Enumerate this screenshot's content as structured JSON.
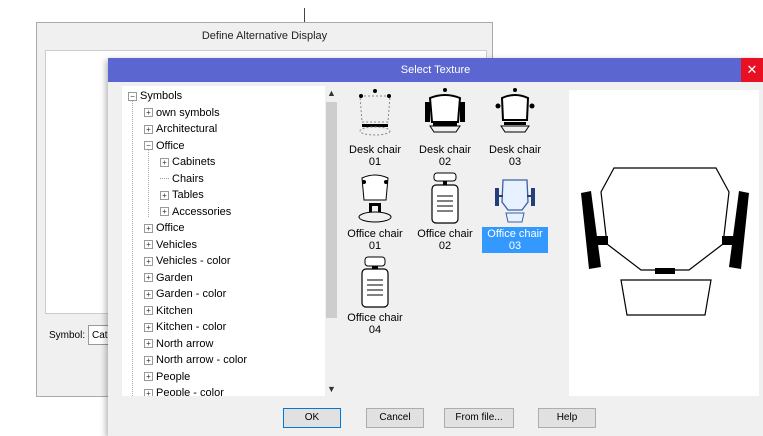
{
  "background_dialog": {
    "title": "Define Alternative Display",
    "symbol_label": "Symbol:",
    "symbol_value": "Cata"
  },
  "dialog": {
    "title": "Select Texture",
    "close_glyph": "✕"
  },
  "tree": {
    "items": [
      {
        "label": "Symbols",
        "indent": 0,
        "expander": "−"
      },
      {
        "label": "own symbols",
        "indent": 1,
        "expander": "+"
      },
      {
        "label": "Architectural",
        "indent": 1,
        "expander": "+"
      },
      {
        "label": "Office",
        "indent": 1,
        "expander": "−"
      },
      {
        "label": "Cabinets",
        "indent": 2,
        "expander": "+"
      },
      {
        "label": "Chairs",
        "indent": 2,
        "expander": ""
      },
      {
        "label": "Tables",
        "indent": 2,
        "expander": "+"
      },
      {
        "label": "Accessories",
        "indent": 2,
        "expander": "+"
      },
      {
        "label": "Office",
        "indent": 1,
        "expander": "+"
      },
      {
        "label": "Vehicles",
        "indent": 1,
        "expander": "+"
      },
      {
        "label": "Vehicles - color",
        "indent": 1,
        "expander": "+"
      },
      {
        "label": "Garden",
        "indent": 1,
        "expander": "+"
      },
      {
        "label": "Garden - color",
        "indent": 1,
        "expander": "+"
      },
      {
        "label": "Kitchen",
        "indent": 1,
        "expander": "+"
      },
      {
        "label": "Kitchen - color",
        "indent": 1,
        "expander": "+"
      },
      {
        "label": "North arrow",
        "indent": 1,
        "expander": "+"
      },
      {
        "label": "North arrow - color",
        "indent": 1,
        "expander": "+"
      },
      {
        "label": "People",
        "indent": 1,
        "expander": "+"
      },
      {
        "label": "People - color",
        "indent": 1,
        "expander": "+"
      }
    ]
  },
  "thumbnails": [
    {
      "label": "Desk chair 01",
      "icon": "desk-chair-01-icon",
      "selected": false
    },
    {
      "label": "Desk chair 02",
      "icon": "desk-chair-02-icon",
      "selected": false
    },
    {
      "label": "Desk chair 03",
      "icon": "desk-chair-03-icon",
      "selected": false
    },
    {
      "label": "Office chair 01",
      "icon": "office-chair-01-icon",
      "selected": false
    },
    {
      "label": "Office chair 02",
      "icon": "office-chair-02-icon",
      "selected": false
    },
    {
      "label": "Office chair 03",
      "icon": "office-chair-03-icon",
      "selected": true
    },
    {
      "label": "Office chair 04",
      "icon": "office-chair-04-icon",
      "selected": false
    }
  ],
  "buttons": {
    "ok": "OK",
    "cancel": "Cancel",
    "from_file": "From file...",
    "help": "Help"
  },
  "colors": {
    "title_bar": "#5b66d1",
    "selection": "#3399ff",
    "close": "#e81123"
  }
}
